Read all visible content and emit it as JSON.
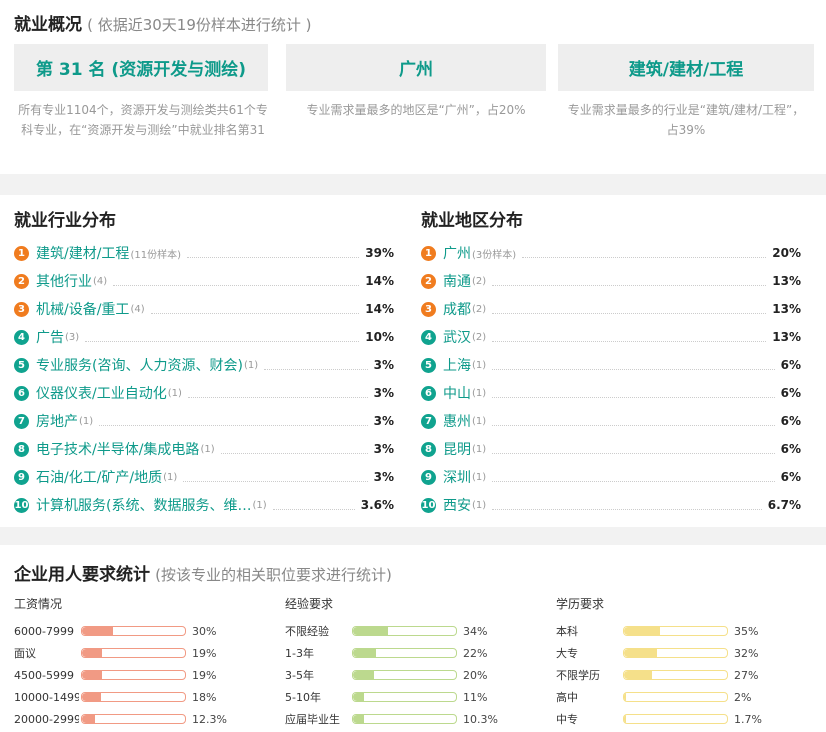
{
  "overview": {
    "title": "就业概况",
    "subtitle": "( 依据近30天19份样本进行统计 )",
    "cards": [
      {
        "label": "第 31 名 (资源开发与测绘)",
        "desc": "所有专业1104个，资源开发与测绘类共61个专科专业，在“资源开发与测绘”中就业排名第31"
      },
      {
        "label": "广州",
        "desc": "专业需求量最多的地区是“广州”，占20%"
      },
      {
        "label": "建筑/建材/工程",
        "desc": "专业需求量最多的行业是“建筑/建材/工程”，占39%"
      }
    ]
  },
  "industry": {
    "title": "就业行业分布",
    "items": [
      {
        "rank": "1",
        "name": "建筑/建材/工程",
        "count": "(11份样本)",
        "pct": "39%",
        "color": "#f07c1f"
      },
      {
        "rank": "2",
        "name": "其他行业",
        "count": "(4)",
        "pct": "14%",
        "color": "#f07c1f"
      },
      {
        "rank": "3",
        "name": "机械/设备/重工",
        "count": "(4)",
        "pct": "14%",
        "color": "#f07c1f"
      },
      {
        "rank": "4",
        "name": "广告",
        "count": "(3)",
        "pct": "10%",
        "color": "#10a38f"
      },
      {
        "rank": "5",
        "name": "专业服务(咨询、人力资源、财会)",
        "count": "(1)",
        "pct": "3%",
        "color": "#10a38f"
      },
      {
        "rank": "6",
        "name": "仪器仪表/工业自动化",
        "count": "(1)",
        "pct": "3%",
        "color": "#10a38f"
      },
      {
        "rank": "7",
        "name": "房地产",
        "count": "(1)",
        "pct": "3%",
        "color": "#10a38f"
      },
      {
        "rank": "8",
        "name": "电子技术/半导体/集成电路",
        "count": "(1)",
        "pct": "3%",
        "color": "#10a38f"
      },
      {
        "rank": "9",
        "name": "石油/化工/矿产/地质",
        "count": "(1)",
        "pct": "3%",
        "color": "#10a38f"
      },
      {
        "rank": "10",
        "name": "计算机服务(系统、数据服务、维…",
        "count": "(1)",
        "pct": "3.6%",
        "color": "#10a38f"
      }
    ]
  },
  "region": {
    "title": "就业地区分布",
    "items": [
      {
        "rank": "1",
        "name": "广州",
        "count": "(3份样本)",
        "pct": "20%",
        "color": "#f07c1f"
      },
      {
        "rank": "2",
        "name": "南通",
        "count": "(2)",
        "pct": "13%",
        "color": "#f07c1f"
      },
      {
        "rank": "3",
        "name": "成都",
        "count": "(2)",
        "pct": "13%",
        "color": "#f07c1f"
      },
      {
        "rank": "4",
        "name": "武汉",
        "count": "(2)",
        "pct": "13%",
        "color": "#10a38f"
      },
      {
        "rank": "5",
        "name": "上海",
        "count": "(1)",
        "pct": "6%",
        "color": "#10a38f"
      },
      {
        "rank": "6",
        "name": "中山",
        "count": "(1)",
        "pct": "6%",
        "color": "#10a38f"
      },
      {
        "rank": "7",
        "name": "惠州",
        "count": "(1)",
        "pct": "6%",
        "color": "#10a38f"
      },
      {
        "rank": "8",
        "name": "昆明",
        "count": "(1)",
        "pct": "6%",
        "color": "#10a38f"
      },
      {
        "rank": "9",
        "name": "深圳",
        "count": "(1)",
        "pct": "6%",
        "color": "#10a38f"
      },
      {
        "rank": "10",
        "name": "西安",
        "count": "(1)",
        "pct": "6.7%",
        "color": "#10a38f"
      }
    ]
  },
  "requirements": {
    "title": "企业用人要求统计",
    "subtitle": "(按该专业的相关职位要求进行统计)",
    "columns": [
      {
        "title": "工资情况",
        "color": "#f19a84",
        "rows": [
          {
            "label": "6000-7999",
            "pct": "30%",
            "value": 30
          },
          {
            "label": "面议",
            "pct": "19%",
            "value": 19
          },
          {
            "label": "4500-5999",
            "pct": "19%",
            "value": 19
          },
          {
            "label": "10000-1499",
            "pct": "18%",
            "value": 18
          },
          {
            "label": "20000-2999",
            "pct": "12.3%",
            "value": 12.3
          }
        ]
      },
      {
        "title": "经验要求",
        "color": "#bcd98e",
        "rows": [
          {
            "label": "不限经验",
            "pct": "34%",
            "value": 34
          },
          {
            "label": "1-3年",
            "pct": "22%",
            "value": 22
          },
          {
            "label": "3-5年",
            "pct": "20%",
            "value": 20
          },
          {
            "label": "5-10年",
            "pct": "11%",
            "value": 11
          },
          {
            "label": "应届毕业生",
            "pct": "10.3%",
            "value": 10.3
          }
        ]
      },
      {
        "title": "学历要求",
        "color": "#f5e08a",
        "rows": [
          {
            "label": "本科",
            "pct": "35%",
            "value": 35
          },
          {
            "label": "大专",
            "pct": "32%",
            "value": 32
          },
          {
            "label": "不限学历",
            "pct": "27%",
            "value": 27
          },
          {
            "label": "高中",
            "pct": "2%",
            "value": 2
          },
          {
            "label": "中专",
            "pct": "1.7%",
            "value": 1.7
          }
        ]
      }
    ]
  }
}
